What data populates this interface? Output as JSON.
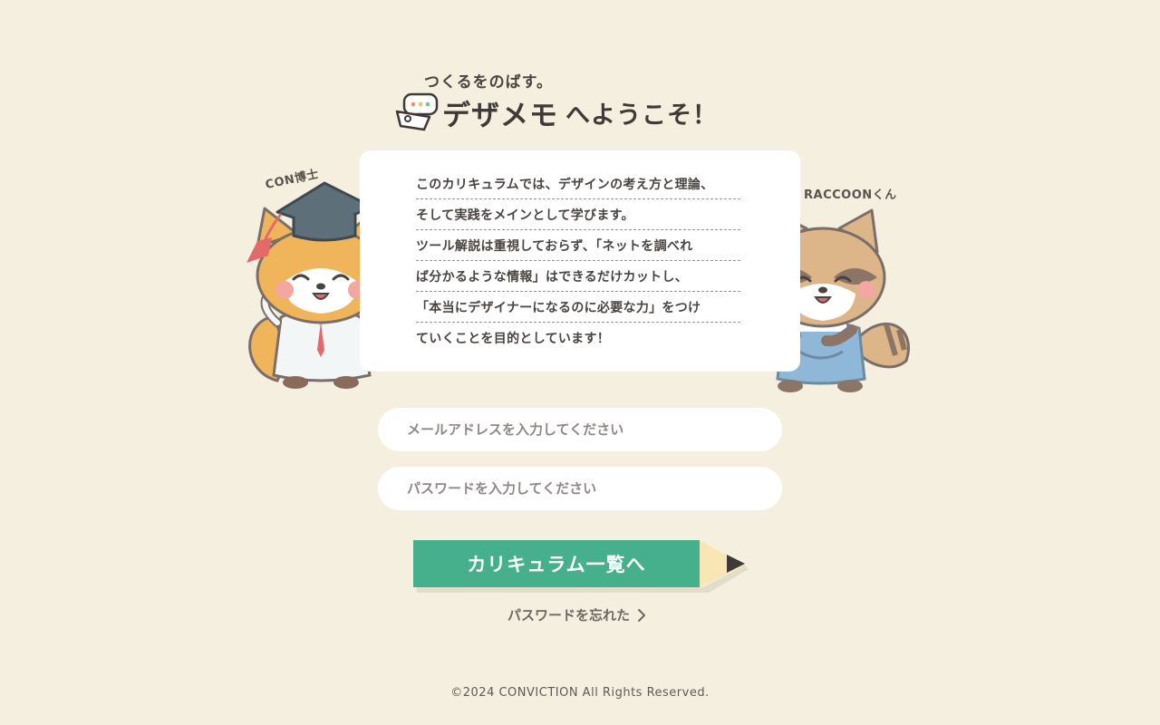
{
  "header": {
    "tagline": "つくるをのばす。",
    "brand": "デザメモ",
    "welcome": "へようこそ！"
  },
  "intro": {
    "lines": [
      "このカリキュラムでは、デザインの考え方と理論、",
      "そして実践をメインとして学びます。",
      "ツール解説は重視しておらず、「ネットを調べれ",
      "ば分かるような情報」はできるだけカットし、",
      "「本当にデザイナーになるのに必要な力」をつけ",
      "ていくことを目的としています！"
    ]
  },
  "characters": {
    "left_label": "CON博士",
    "right_label": "RACCOONくん"
  },
  "form": {
    "email_placeholder": "メールアドレスを入力してください",
    "email_value": "",
    "password_placeholder": "パスワードを入力してください",
    "password_value": "",
    "submit_label": "カリキュラム一覧へ",
    "forgot_label": "パスワードを忘れた"
  },
  "footer": {
    "copyright": "©2024 CONVICTION All Rights Reserved."
  },
  "colors": {
    "background": "#f4efdf",
    "accent": "#46b08c",
    "text": "#4a4441"
  },
  "icons": {
    "logo": "speech-bubble-pencil-icon",
    "submit_tip": "pencil-tip-icon",
    "forgot_arrow": "chevron-right-icon"
  }
}
